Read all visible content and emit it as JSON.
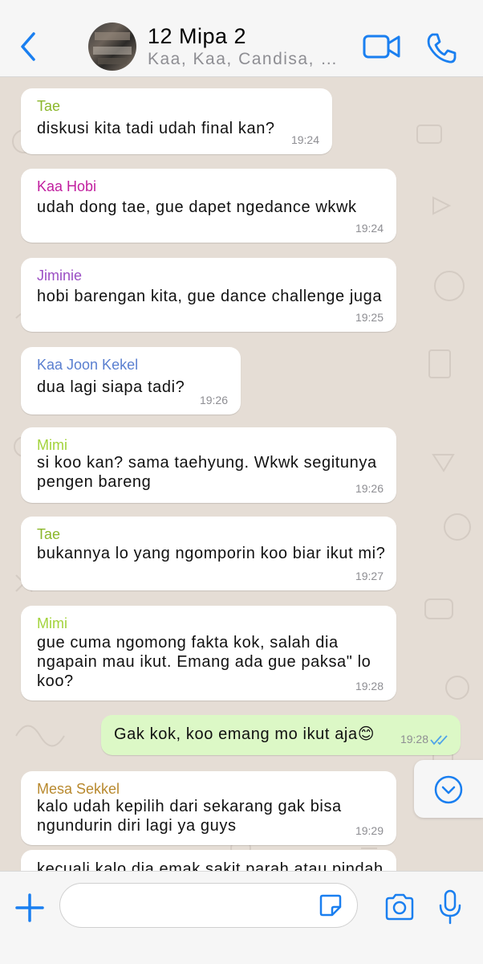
{
  "header": {
    "title": "12 Mipa 2",
    "subtitle": "Kaa, Kaa, Candisa, Mi..."
  },
  "messages": [
    {
      "sender": "Tae",
      "sender_color": "#8bb72a",
      "lines": [
        "diskusi kita tadi udah final kan?"
      ],
      "time": "19:24"
    },
    {
      "sender": "Kaa Hobi",
      "sender_color": "#c11f9f",
      "lines": [
        "udah dong tae, gue dapet ngedance wkwk"
      ],
      "time": "19:24"
    },
    {
      "sender": "Jiminie",
      "sender_color": "#9b4fc4",
      "lines": [
        "hobi barengan kita, gue dance challenge juga"
      ],
      "time": "19:25"
    },
    {
      "sender": "Kaa Joon Kekel",
      "sender_color": "#5a7fd0",
      "lines": [
        "dua lagi siapa tadi?"
      ],
      "time": "19:26"
    },
    {
      "sender": "Mimi",
      "sender_color": "#a3d33c",
      "lines": [
        "si koo kan? sama taehyung. Wkwk segitunya",
        "pengen bareng"
      ],
      "time": "19:26"
    },
    {
      "sender": "Tae",
      "sender_color": "#8bb72a",
      "lines": [
        "bukannya lo yang ngomporin koo biar ikut mi?"
      ],
      "time": "19:27"
    },
    {
      "sender": "Mimi",
      "sender_color": "#a3d33c",
      "lines": [
        "gue cuma ngomong fakta kok, salah dia",
        "ngapain mau ikut. Emang ada gue paksa\" lo",
        "koo?"
      ],
      "time": "19:28"
    },
    {
      "sender": "Mesa Sekkel",
      "sender_color": "#b8892e",
      "lines": [
        "kalo udah kepilih dari sekarang gak bisa",
        "ngundurin diri lagi ya guys"
      ],
      "time": "19:29"
    },
    {
      "sender": "",
      "sender_color": "#000000",
      "lines": [
        "kecuali kalo dia emak sakit parah atau pindah"
      ],
      "time": ""
    }
  ],
  "outgoing": {
    "text": "Gak kok, koo emang mo ikut aja😊",
    "time": "19:28",
    "status_icon": "double-check-read-icon"
  },
  "composer": {
    "placeholder": ""
  },
  "colors": {
    "accent": "#1a7ff0",
    "outgoing_bubble": "#dcf8c6",
    "chat_background": "#e5ddd5"
  }
}
